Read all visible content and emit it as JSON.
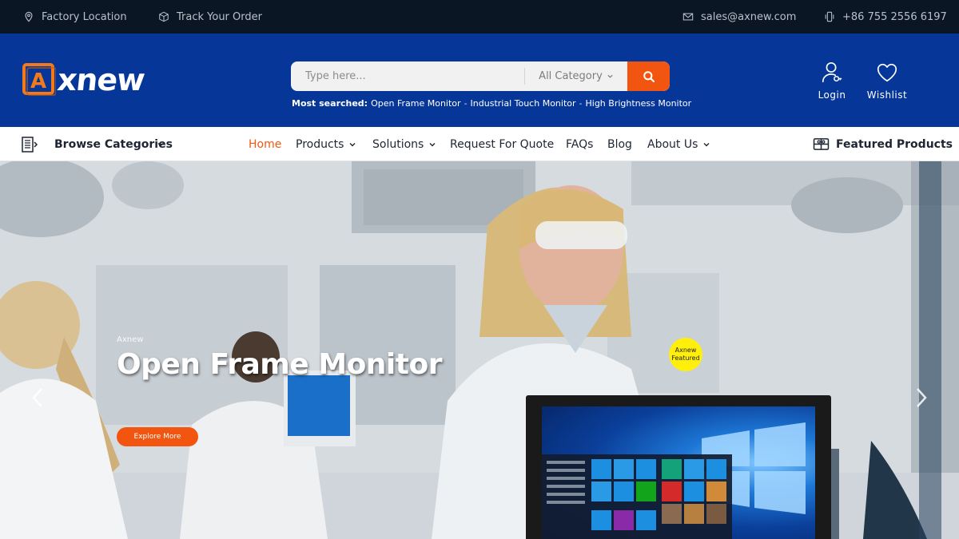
{
  "topbar": {
    "factory_location": "Factory Location",
    "track_order": "Track Your Order",
    "email": "sales@axnew.com",
    "phone": "+86 755 2556 6197"
  },
  "header": {
    "logo_text": "xnew",
    "logo_letter": "A",
    "search": {
      "placeholder": "Type here...",
      "category": "All Category"
    },
    "most_searched": {
      "label": "Most searched:",
      "items": [
        "Open Frame Monitor",
        "Industrial Touch Monitor",
        "High Brightness Monitor"
      ]
    },
    "login_label": "Login",
    "wishlist_label": "Wishlist"
  },
  "nav": {
    "browse_label": "Browse Categories",
    "items": [
      "Home",
      "Products",
      "Solutions",
      "Request For Quote",
      "FAQs",
      "Blog",
      "About Us"
    ],
    "featured_label": "Featured Products"
  },
  "hero": {
    "kicker": "Axnew",
    "title": "Open Frame Monitor",
    "cta": "Explore More",
    "badge_line1": "Axnew",
    "badge_line2": "Featured"
  },
  "colors": {
    "accent": "#f2550f",
    "header_bg": "#063798",
    "topbar_bg": "#0b1624",
    "badge": "#ffef0a"
  }
}
